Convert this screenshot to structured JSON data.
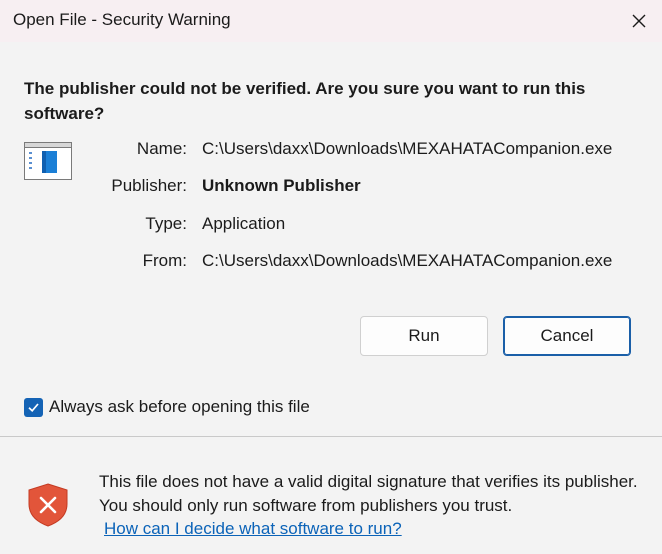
{
  "window": {
    "title": "Open File - Security Warning",
    "close_icon": "close-icon"
  },
  "warning": {
    "heading": "The publisher could not be verified.  Are you sure you want to run this software?"
  },
  "file_info": {
    "icon": "application-icon",
    "rows": [
      {
        "label": "Name:",
        "value": "C:\\Users\\daxx\\Downloads\\MEXAHATACompanion.exe"
      },
      {
        "label": "Publisher:",
        "value": "Unknown Publisher"
      },
      {
        "label": "Type:",
        "value": "Application"
      },
      {
        "label": "From:",
        "value": "C:\\Users\\daxx\\Downloads\\MEXAHATACompanion.exe"
      }
    ]
  },
  "buttons": {
    "run_label": "Run",
    "cancel_label": "Cancel"
  },
  "checkbox": {
    "label": "Always ask before opening this file",
    "checked": true
  },
  "footer": {
    "icon": "warning-shield-icon",
    "text": "This file does not have a valid digital signature that verifies its publisher.  You should only run software from publishers you trust.",
    "link_text": "How can I decide what software to run?"
  },
  "colors": {
    "accent": "#1463b5",
    "link": "#0b63b8",
    "shield": "#e2553a",
    "titlebar": "#f7eff2"
  }
}
